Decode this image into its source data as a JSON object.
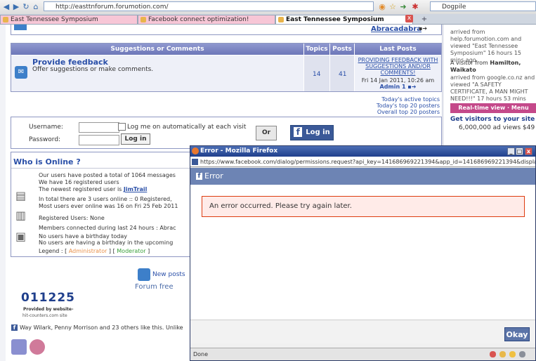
{
  "browser": {
    "url": "http://easttnforum.forumotion.com/",
    "search_engine": "Dogpile",
    "tabs": [
      {
        "label": "East Tennessee Symposium",
        "active": false
      },
      {
        "label": "Facebook connect optimization!",
        "active": false
      },
      {
        "label": "East Tennessee Symposium",
        "active": true
      }
    ],
    "tab_close": "x"
  },
  "forum": {
    "top_link": "Abracadabra",
    "suggestions": {
      "headers": {
        "title": "Suggestions or Comments",
        "topics": "Topics",
        "posts": "Posts",
        "last_posts": "Last Posts"
      },
      "forum_name": "Provide feedback",
      "forum_desc": "Offer suggestions or make comments.",
      "topics": "14",
      "posts": "41",
      "last_post_title": "PROVIDING FEEDBACK WITH SUGGESTIONS AND/OR COMMENTS!",
      "last_post_date": "Fri 14 Jan 2011, 10:26 am",
      "last_post_author": "Admin 1"
    },
    "quick_links": [
      "Today's active topics",
      "Today's top 20 posters",
      "Overall top 20 posters"
    ],
    "login": {
      "username_label": "Username:",
      "password_label": "Password:",
      "remember_label": "Log me on automatically at each visit",
      "login_button": "Log in",
      "or_label": "Or",
      "fb_login": "Log in"
    },
    "who_online": {
      "title": "Who is Online ?",
      "line1": "Our users have posted a total of 1064 messages",
      "line2": "We have 16 registered users",
      "line3_prefix": "The newest registered user is ",
      "newest_user": "JimTrail",
      "line4": "In total there are 3 users online :: 0 Registered,",
      "line5": "Most users ever online was 16 on Fri 25 Feb 2011",
      "registered": "Registered Users: None",
      "connected": "Members connected during last 24 hours : Abrac",
      "birthday1": "No users have a birthday today",
      "birthday2": "No users are having a birthday in the upcoming",
      "legend_label": "Legend :",
      "legend_admin": "Administrator",
      "legend_mod": "Moderator"
    },
    "new_posts": "New posts",
    "forum_free": "Forum free",
    "counter": "011225",
    "counter_provided": "Provided by website-",
    "counter_site": "hit-counters.com site",
    "fb_like": "Way Wilark, Penny Morrison and 23 others like this. Unlike"
  },
  "sidebar": {
    "item1": "arrived from help.forumotion.com and viewed \"East Tennessee Symposium\" 16 hours 15 mins ago",
    "item2_prefix": "A visitor from ",
    "item2_place": "Hamilton, Waikato",
    "item2_body": "arrived from google.co.nz and viewed \"A SAFETY CERTIFICATE, A MAN MIGHT NEED!!!\" 17 hours 53 mins ago",
    "realtime": "Real-time view · Menu",
    "get_visitors": "Get visitors to your site",
    "ad_views": "6,000,000 ad views $49"
  },
  "popup": {
    "title": "Error - Mozilla Firefox",
    "url": "https://www.facebook.com/dialog/permissions.request?api_key=141686969221394&app_id=141686969221394&displa",
    "fb_header": "Error",
    "error_message": "An error occurred. Please try again later.",
    "okay_button": "Okay",
    "status": "Done",
    "win_min": "_",
    "win_max": "□",
    "win_close": "x"
  },
  "colors": {
    "forum_header": "#7a83c2",
    "facebook_blue": "#3b5998",
    "error_bg": "#ffebe8",
    "error_border": "#dd3c10"
  }
}
